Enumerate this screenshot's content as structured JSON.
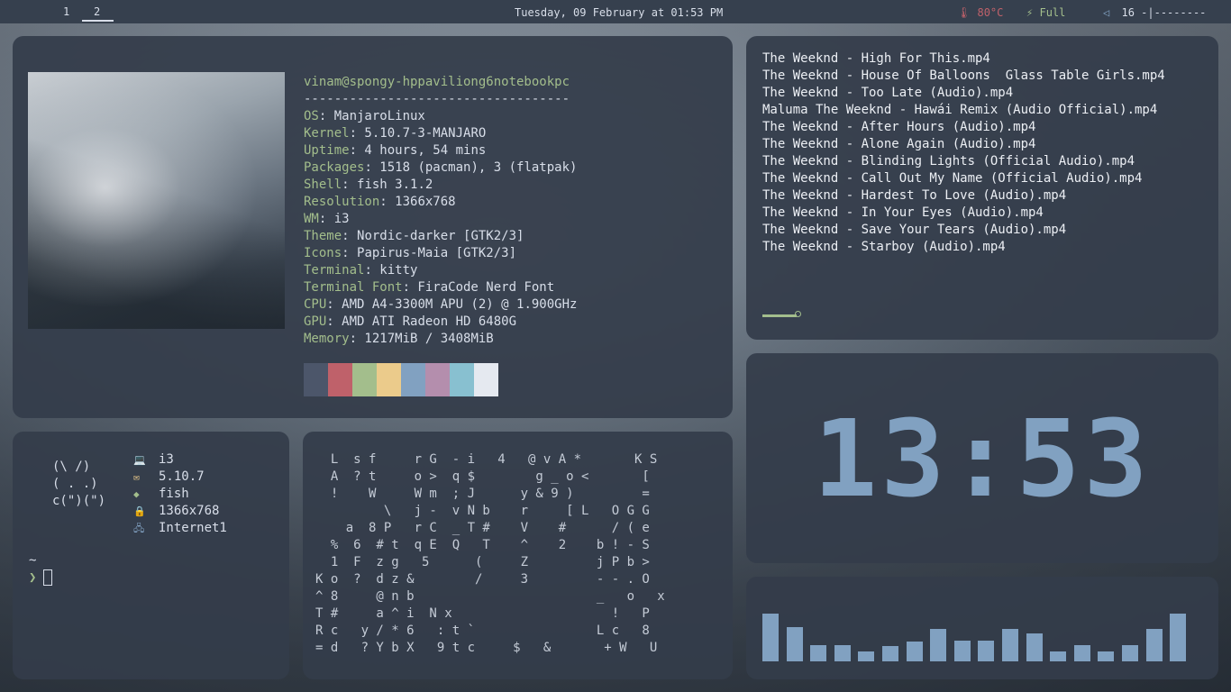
{
  "topbar": {
    "workspaces": [
      "1",
      "2"
    ],
    "active_workspace": "2",
    "datetime": "Tuesday, 09 February at 01:53 PM",
    "temp_icon": "thermometer-icon",
    "temperature": "80°C",
    "battery_icon": "battery-charging-icon",
    "battery": "Full",
    "volume_icon": "speaker-icon",
    "volume": "16",
    "volume_bar": "-|--------",
    "colors": {
      "bar_bg": "#36404e",
      "temp": "#bf616a",
      "battery": "#a3be8c"
    }
  },
  "neofetch": {
    "user_host": "vinam@spongy-hppaviliong6notebookpc",
    "separator": "-----------------------------------",
    "fields": [
      {
        "key": "OS",
        "value": "ManjaroLinux"
      },
      {
        "key": "Kernel",
        "value": "5.10.7-3-MANJARO"
      },
      {
        "key": "Uptime",
        "value": "4 hours, 54 mins"
      },
      {
        "key": "Packages",
        "value": "1518 (pacman), 3 (flatpak)"
      },
      {
        "key": "Shell",
        "value": "fish 3.1.2"
      },
      {
        "key": "Resolution",
        "value": "1366x768"
      },
      {
        "key": "WM",
        "value": "i3"
      },
      {
        "key": "Theme",
        "value": "Nordic-darker [GTK2/3]"
      },
      {
        "key": "Icons",
        "value": "Papirus-Maia [GTK2/3]"
      },
      {
        "key": "Terminal",
        "value": "kitty"
      },
      {
        "key": "Terminal Font",
        "value": "FiraCode Nerd Font"
      },
      {
        "key": "CPU",
        "value": "AMD A4-3300M APU (2) @ 1.900GHz"
      },
      {
        "key": "GPU",
        "value": "AMD ATI Radeon HD 6480G"
      },
      {
        "key": "Memory",
        "value": "1217MiB / 3408MiB"
      }
    ],
    "palette": [
      "#4c566a",
      "#bf616a",
      "#a3be8c",
      "#ebcb8b",
      "#81a1c1",
      "#b48ead",
      "#88c0d0",
      "#e5e9f0"
    ]
  },
  "playlist": {
    "tracks": [
      "The Weeknd - High For This.mp4",
      "The Weeknd - House Of Balloons  Glass Table Girls.mp4",
      "The Weeknd - Too Late (Audio).mp4",
      "Maluma The Weeknd - Hawái Remix (Audio Official).mp4",
      "The Weeknd - After Hours (Audio).mp4",
      "The Weeknd - Alone Again (Audio).mp4",
      "The Weeknd - Blinding Lights (Official Audio).mp4",
      "The Weeknd - Call Out My Name (Official Audio).mp4",
      "The Weeknd - Hardest To Love (Audio).mp4",
      "The Weeknd - In Your Eyes (Audio).mp4",
      "The Weeknd - Save Your Tears (Audio).mp4",
      "The Weeknd - Starboy (Audio).mp4"
    ],
    "progress_fraction": 0.06
  },
  "clock": {
    "time": "13:53"
  },
  "visualizer": {
    "levels": [
      0.88,
      0.64,
      0.3,
      0.3,
      0.18,
      0.28,
      0.36,
      0.6,
      0.38,
      0.38,
      0.6,
      0.52,
      0.18,
      0.3,
      0.18,
      0.3,
      0.6,
      0.88
    ]
  },
  "pfetch": {
    "cat": "(\\ /)\n( . .)\nc(\")(\")",
    "rows": [
      {
        "icon": "laptop-icon",
        "value": "i3"
      },
      {
        "icon": "mail-icon",
        "value": "5.10.7"
      },
      {
        "icon": "diamond-icon",
        "value": "fish"
      },
      {
        "icon": "lock-icon",
        "value": "1366x768"
      },
      {
        "icon": "network-icon",
        "value": "Internet1"
      }
    ],
    "prompt_dir": "~",
    "prompt_arrow": "❯"
  },
  "matrix": {
    "lines": [
      "  L  s f     r G  - i   4   @ v A *       K S",
      "  A  ? t     o >  q $        g _ o <       [",
      "  !    W     W m  ; J      y & 9 )         =",
      "         \\   j -  v N b    r     [ L   O G G",
      "    a  8 P   r C  _ T #    V    #      / ( e",
      "  %  6  # t  q E  Q   T    ^    2    b ! - S",
      "  1  F  z g   5      (     Z         j P b >",
      "K o  ?  d z &        /     3         - - . O",
      "^ 8     @ n b                        _   o   x",
      "T #     a ^ i  N x                     !   P",
      "R c   y / * 6   : t `                L c   8",
      "= d   ? Y b X   9 t c     $   &       + W   U"
    ]
  }
}
